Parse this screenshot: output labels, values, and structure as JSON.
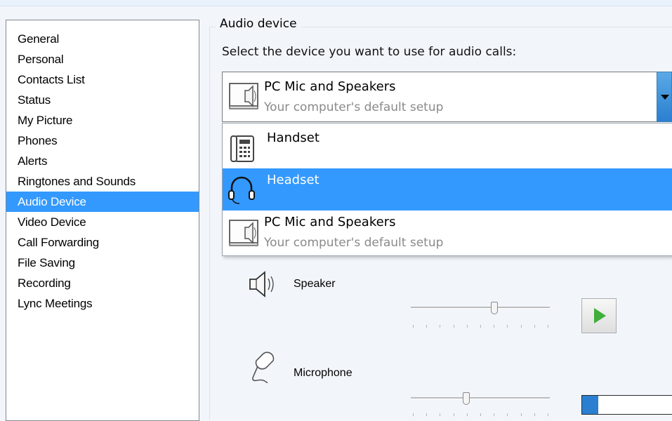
{
  "nav": {
    "items": [
      {
        "label": "General"
      },
      {
        "label": "Personal"
      },
      {
        "label": "Contacts List"
      },
      {
        "label": "Status"
      },
      {
        "label": "My Picture"
      },
      {
        "label": "Phones"
      },
      {
        "label": "Alerts"
      },
      {
        "label": "Ringtones and Sounds"
      },
      {
        "label": "Audio Device",
        "selected": true
      },
      {
        "label": "Video Device"
      },
      {
        "label": "Call Forwarding"
      },
      {
        "label": "File Saving"
      },
      {
        "label": "Recording"
      },
      {
        "label": "Lync Meetings"
      }
    ]
  },
  "audio_device": {
    "group_title": "Audio device",
    "instruction": "Select the device you want to use for audio calls:",
    "combo": {
      "selected_label": "PC Mic and Speakers",
      "selected_sub": "Your computer's default setup",
      "icon": "pc-speaker-icon"
    },
    "options": [
      {
        "label": "Handset",
        "sub": "",
        "icon": "handset-icon"
      },
      {
        "label": "Headset",
        "sub": "",
        "icon": "headset-icon",
        "highlighted": true
      },
      {
        "label": "PC Mic and Speakers",
        "sub": "Your computer's default setup",
        "icon": "pc-speaker-icon"
      }
    ]
  },
  "speaker": {
    "label": "Speaker",
    "icon": "speaker-icon",
    "volume_fraction": 0.6,
    "play_icon": "play-icon"
  },
  "microphone": {
    "label": "Microphone",
    "icon": "microphone-icon",
    "volume_fraction": 0.4,
    "level_fraction": 0.17
  },
  "colors": {
    "selection": "#3399ff",
    "play_green": "#3fae3a",
    "meter_blue": "#2b7fd0"
  }
}
